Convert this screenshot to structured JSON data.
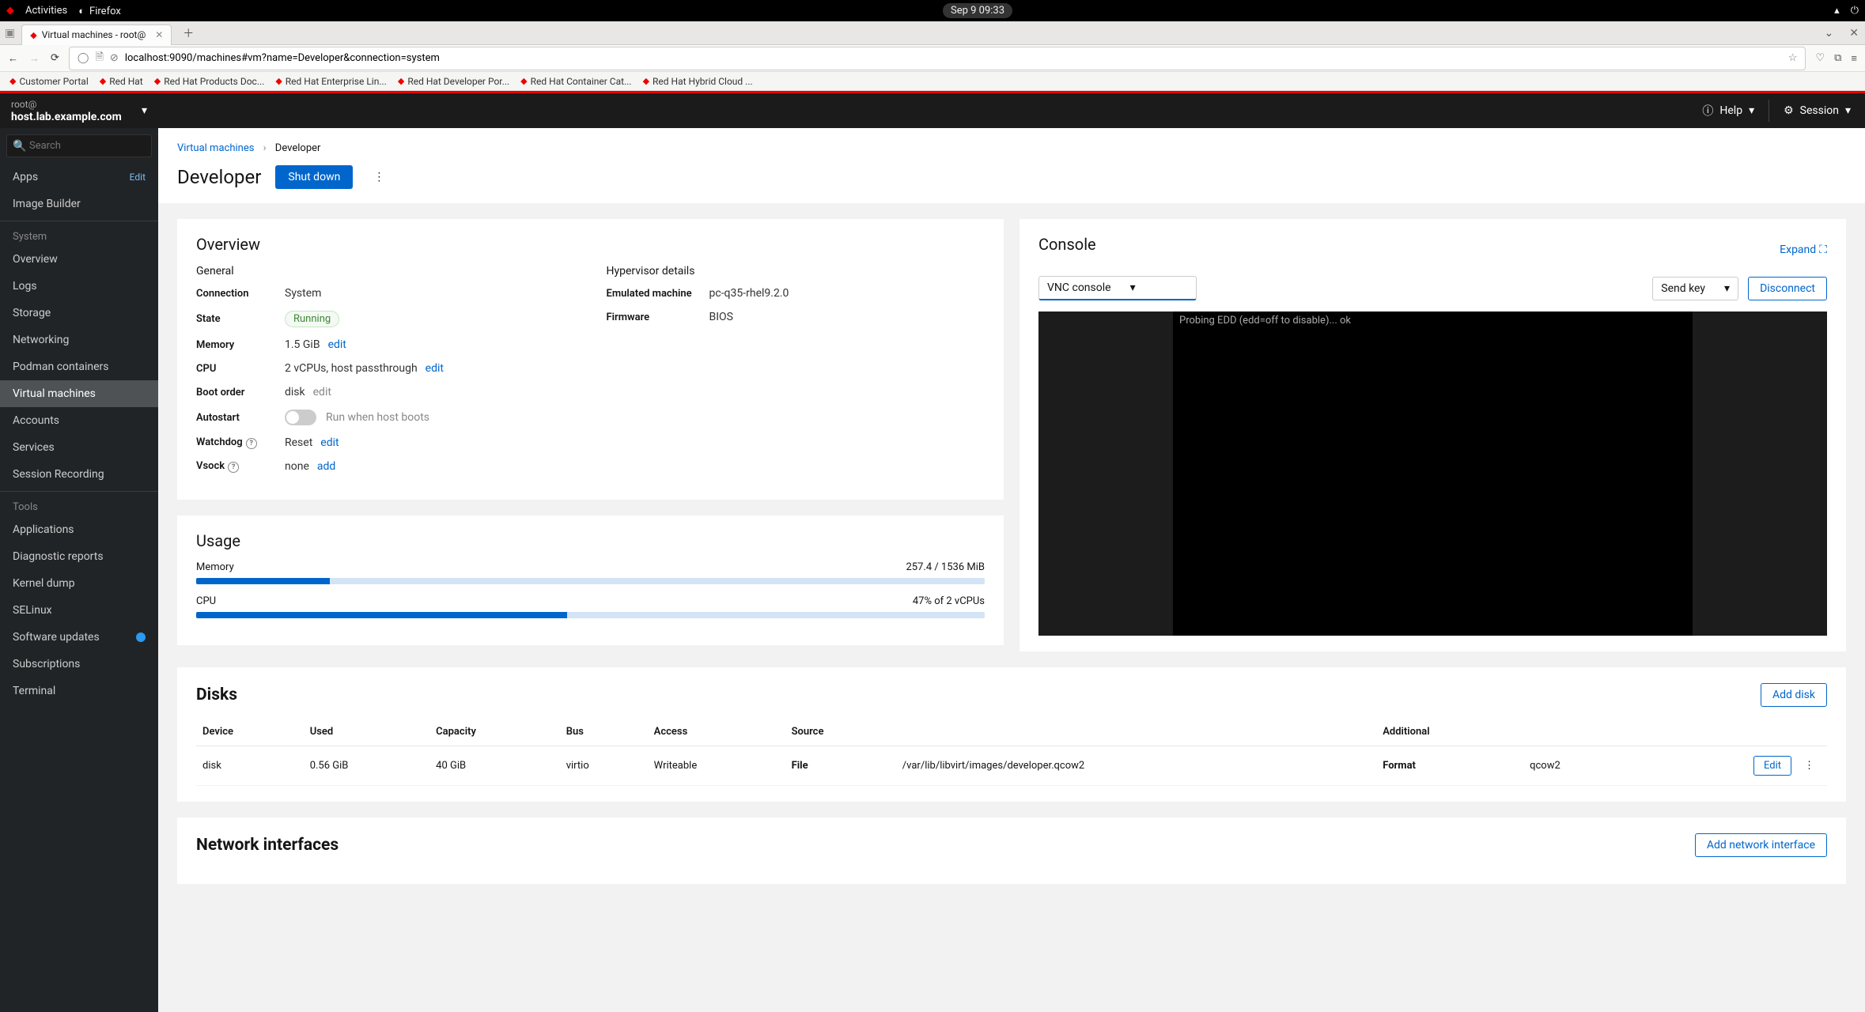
{
  "gnome": {
    "activities": "Activities",
    "firefox": "Firefox",
    "clock": "Sep 9  09:33"
  },
  "tab": {
    "title": "Virtual machines - root@"
  },
  "url": "localhost:9090/machines#vm?name=Developer&connection=system",
  "bookmarks": [
    "Customer Portal",
    "Red Hat",
    "Red Hat Products Doc...",
    "Red Hat Enterprise Lin...",
    "Red Hat Developer Por...",
    "Red Hat Container Cat...",
    "Red Hat Hybrid Cloud ..."
  ],
  "header": {
    "user": "root@",
    "host": "host.lab.example.com",
    "help": "Help",
    "session": "Session"
  },
  "side": {
    "search_ph": "Search",
    "apps": "Apps",
    "apps_edit": "Edit",
    "img": "Image Builder",
    "grp_system": "System",
    "system_items": [
      "Overview",
      "Logs",
      "Storage",
      "Networking",
      "Podman containers",
      "Virtual machines",
      "Accounts",
      "Services",
      "Session Recording"
    ],
    "selected": "Virtual machines",
    "grp_tools": "Tools",
    "tools_items": [
      "Applications",
      "Diagnostic reports",
      "Kernel dump",
      "SELinux",
      "Software updates",
      "Subscriptions",
      "Terminal"
    ],
    "badge_item": "Software updates"
  },
  "crumbs": {
    "root": "Virtual machines",
    "leaf": "Developer"
  },
  "title": "Developer",
  "shutdown": "Shut down",
  "overview": {
    "h": "Overview",
    "general": "General",
    "hyp": "Hypervisor details",
    "conn_k": "Connection",
    "conn_v": "System",
    "state_k": "State",
    "state_v": "Running",
    "mem_k": "Memory",
    "mem_v": "1.5 GiB",
    "cpu_k": "CPU",
    "cpu_v": "2 vCPUs, host passthrough",
    "boot_k": "Boot order",
    "boot_v": "disk",
    "auto_k": "Autostart",
    "auto_v": "Run when host boots",
    "wd_k": "Watchdog",
    "wd_v": "Reset",
    "vsock_k": "Vsock",
    "vsock_v": "none",
    "emu_k": "Emulated machine",
    "emu_v": "pc-q35-rhel9.2.0",
    "fw_k": "Firmware",
    "fw_v": "BIOS",
    "edit": "edit",
    "add": "add"
  },
  "usage": {
    "h": "Usage",
    "mem_k": "Memory",
    "mem_v": "257.4 / 1536 MiB",
    "mem_pct": 17,
    "cpu_k": "CPU",
    "cpu_v": "47% of 2 vCPUs",
    "cpu_pct": 47
  },
  "console": {
    "h": "Console",
    "expand": "Expand",
    "type": "VNC console",
    "send": "Send key",
    "disconnect": "Disconnect",
    "text": "Probing EDD (edd=off to disable)... ok"
  },
  "disks": {
    "h": "Disks",
    "add": "Add disk",
    "cols": [
      "Device",
      "Used",
      "Capacity",
      "Bus",
      "Access",
      "Source",
      "Additional",
      ""
    ],
    "row": {
      "device": "disk",
      "used": "0.56 GiB",
      "cap": "40 GiB",
      "bus": "virtio",
      "access": "Writeable",
      "src_k": "File",
      "src_v": "/var/lib/libvirt/images/developer.qcow2",
      "add_k": "Format",
      "add_v": "qcow2"
    },
    "edit": "Edit"
  },
  "net": {
    "h": "Network interfaces",
    "add": "Add network interface"
  }
}
